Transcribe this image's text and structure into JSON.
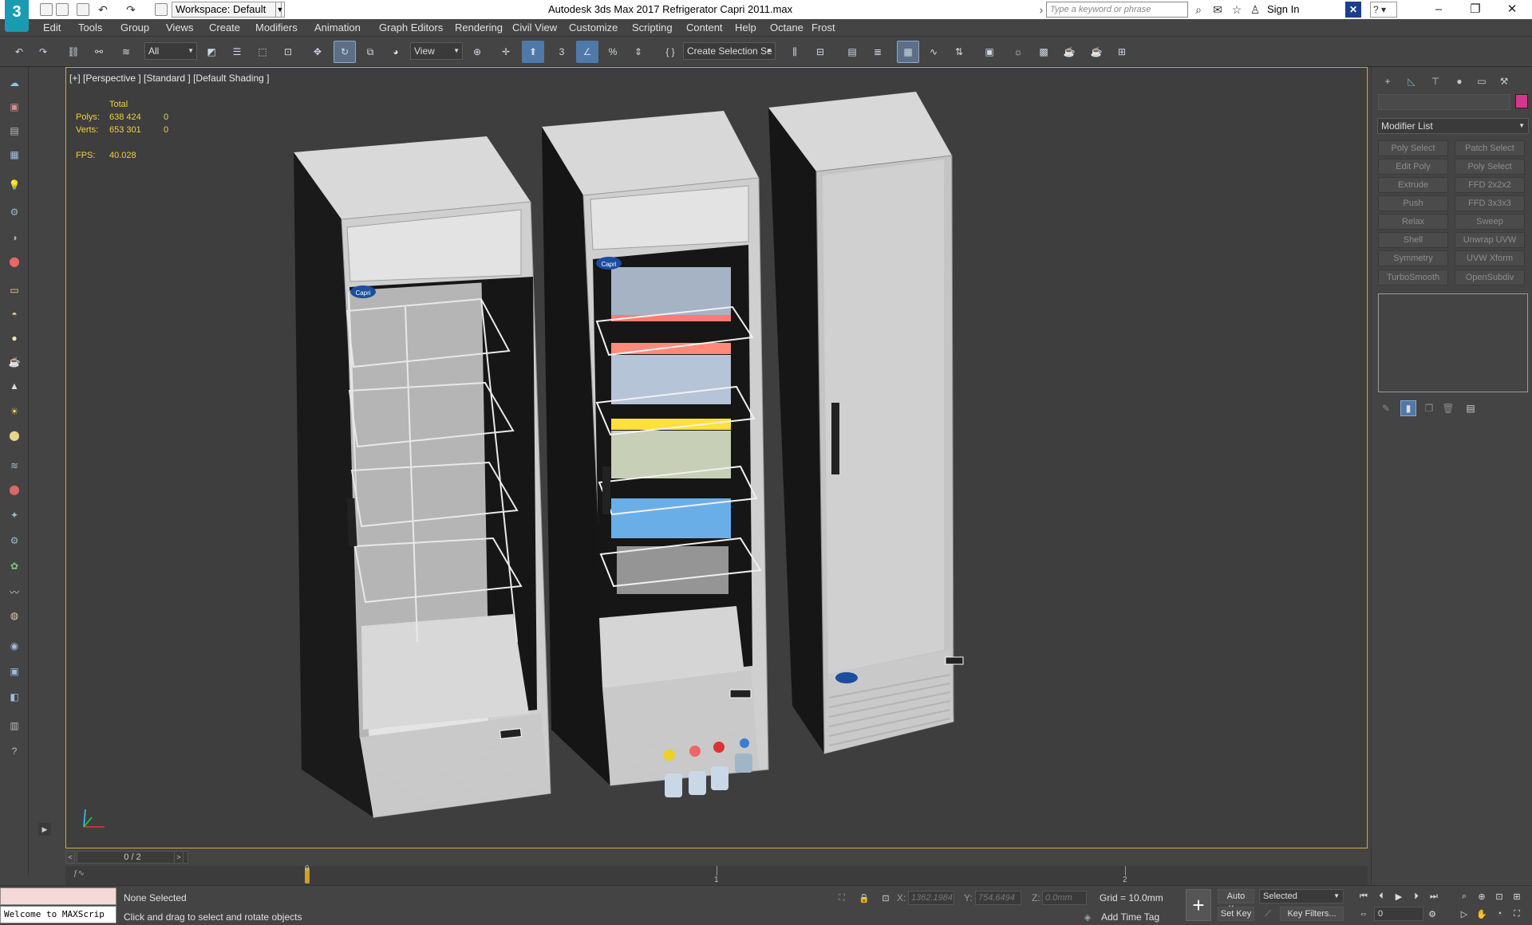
{
  "titlebar": {
    "logo": "3",
    "workspace": "Workspace: Default",
    "title": "Autodesk 3ds Max 2017     Refrigerator Capri 2011.max",
    "search_placeholder": "Type a keyword or phrase",
    "signin": "Sign In"
  },
  "menu": {
    "items": [
      "Edit",
      "Tools",
      "Group",
      "Views",
      "Create",
      "Modifiers",
      "Animation",
      "Graph Editors",
      "Rendering",
      "Civil View",
      "Customize",
      "Scripting",
      "Content",
      "Help",
      "Octane",
      "Frost"
    ]
  },
  "toolbar": {
    "selection_filter": "All",
    "ref_coord": "View",
    "named_selection": "Create Selection Se"
  },
  "viewport": {
    "label": "[+] [Perspective ] [Standard ] [Default Shading ]",
    "stats": {
      "total_label": "Total",
      "polys_label": "Polys:",
      "polys_total": "638 424",
      "polys_sel": "0",
      "verts_label": "Verts:",
      "verts_total": "653 301",
      "verts_sel": "0",
      "fps_label": "FPS:",
      "fps_value": "40.028"
    },
    "logo_text": "Capri"
  },
  "command_panel": {
    "modifier_list": "Modifier List",
    "modifiers": [
      [
        "Poly Select",
        "Patch Select"
      ],
      [
        "Edit Poly",
        "Poly Select"
      ],
      [
        "Extrude",
        "FFD 2x2x2"
      ],
      [
        "Push",
        "FFD 3x3x3"
      ],
      [
        "Relax",
        "Sweep"
      ],
      [
        "Shell",
        "Unwrap UVW"
      ],
      [
        "Symmetry",
        "UVW Xform"
      ],
      [
        "TurboSmooth",
        "OpenSubdiv"
      ]
    ],
    "accent_color": "#d7358c"
  },
  "timeline": {
    "frame_counter": "0 / 2",
    "ticks": [
      "0",
      "1",
      "2"
    ]
  },
  "status": {
    "maxscript": "Welcome to MAXScrip",
    "selection": "None Selected",
    "prompt": "Click and drag to select and rotate objects",
    "x_label": "X:",
    "x_value": "1362.1984",
    "y_label": "Y:",
    "y_value": "754.6494",
    "z_label": "Z:",
    "z_value": "0.0mm",
    "grid": "Grid = 10.0mm",
    "add_time_tag": "Add Time Tag",
    "auto_key": "Auto Key",
    "set_key": "Set Key",
    "key_mode": "Selected",
    "key_filters": "Key Filters...",
    "frame": "0"
  }
}
